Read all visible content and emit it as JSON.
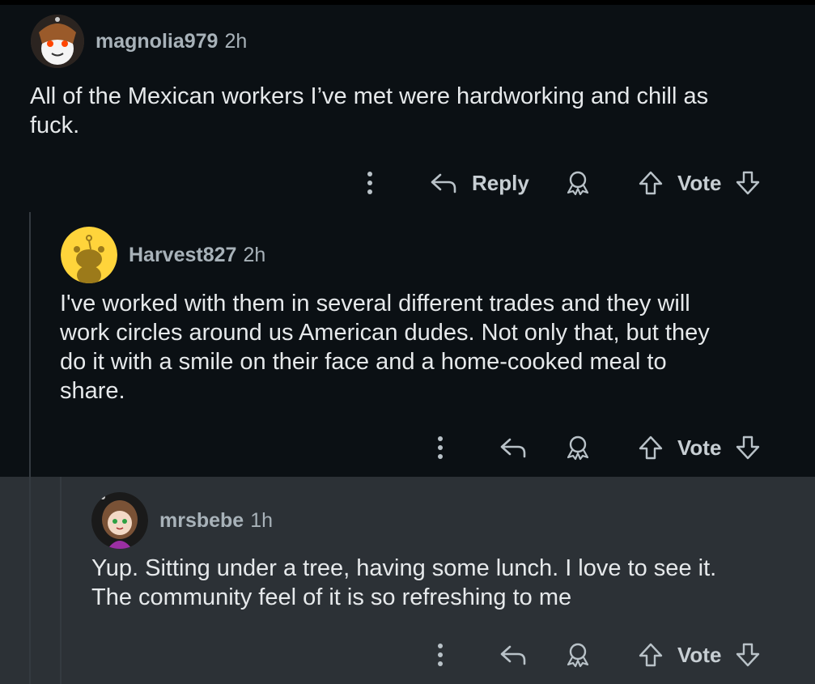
{
  "comments": [
    {
      "username": "magnolia979",
      "time": "2h",
      "text": "All of the Mexican workers I’ve met were hardworking and chill as\nfuck.",
      "actions": {
        "reply": "Reply",
        "vote": "Vote"
      }
    },
    {
      "username": "Harvest827",
      "time": "2h",
      "text": "I've worked with them in several different trades and they will\nwork circles around us American dudes. Not only that, but they\ndo it with a smile on their face and a home-cooked meal to\nshare.",
      "actions": {
        "vote": "Vote"
      }
    },
    {
      "username": "mrsbebe",
      "time": "1h",
      "text": "Yup. Sitting under a tree, having some lunch. I love to see it.\nThe community feel of it is so refreshing to me",
      "actions": {
        "vote": "Vote"
      }
    }
  ],
  "icons": [
    "more-icon",
    "reply-icon",
    "award-icon",
    "upvote-icon",
    "downvote-icon"
  ]
}
